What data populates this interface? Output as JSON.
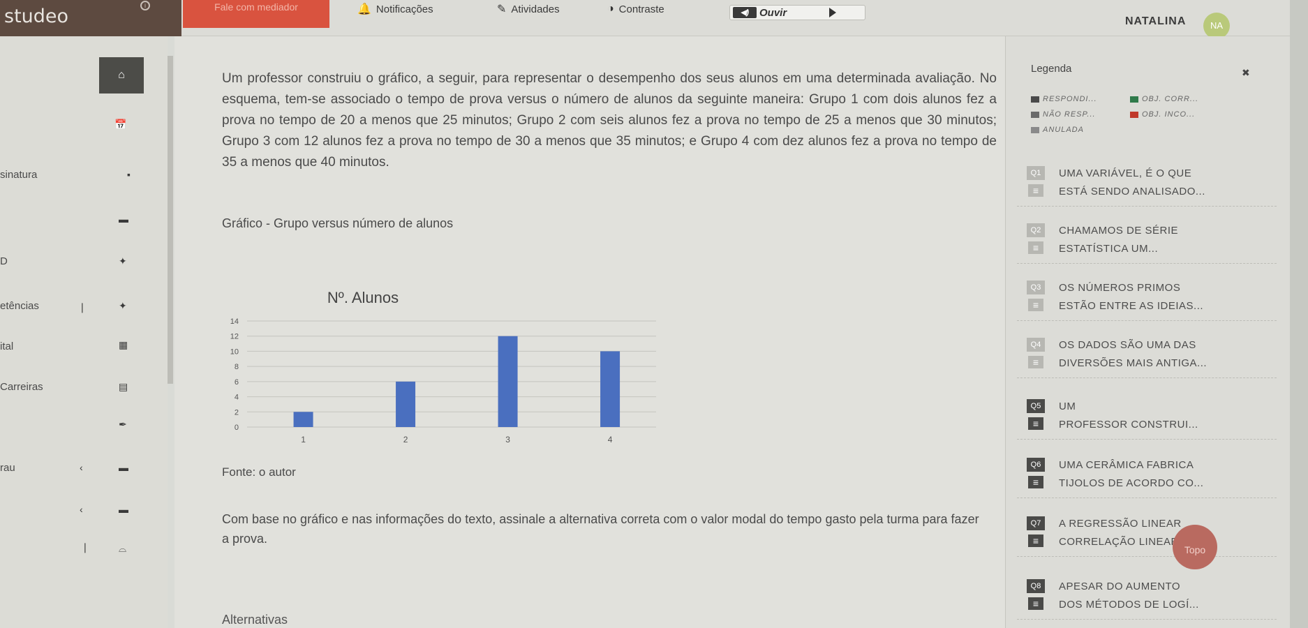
{
  "header": {
    "logo": "studeo",
    "mediator_button": "Fale com mediador",
    "nav": [
      {
        "label": "Notificações",
        "icon": "bell-icon"
      },
      {
        "label": "Atividades",
        "icon": "pencil-icon"
      },
      {
        "label": "Contraste",
        "icon": "contrast-icon"
      }
    ],
    "audio_label": "Ouvir",
    "user_name": "NATALINA",
    "avatar_initials": "NA"
  },
  "left_menu": {
    "items": [
      {
        "label": "",
        "icon": "home-icon"
      },
      {
        "label": "",
        "icon": "calendar-icon"
      },
      {
        "label": "sinatura",
        "icon": "book-icon"
      },
      {
        "label": "",
        "icon": "graduation-cap-icon"
      },
      {
        "label": "D",
        "icon": "puzzle-icon"
      },
      {
        "label": "etências",
        "icon": "puzzle-icon"
      },
      {
        "label": "ital",
        "icon": "calendar-icon"
      },
      {
        "label": "Carreiras",
        "icon": "briefcase-icon"
      },
      {
        "label": "",
        "icon": "pen-icon"
      },
      {
        "label": "rau",
        "icon": "graduation-cap-icon"
      },
      {
        "label": "",
        "icon": "graduation-cap-icon"
      },
      {
        "label": "",
        "icon": "folder-icon"
      }
    ]
  },
  "question": {
    "text": "Um professor construiu o gráfico, a seguir, para representar o desempenho dos seus alunos em uma determinada avaliação. No esquema, tem-se associado o tempo de prova versus o número de alunos da seguinte maneira: Grupo 1 com dois alunos fez a prova no tempo de 20 a menos que 25 minutos; Grupo 2 com seis alunos fez a prova no tempo de 25 a menos que 30 minutos; Grupo 3 com 12 alunos fez a prova no tempo de 30 a menos que 35 minutos; e Grupo 4 com dez alunos fez a prova no tempo de 35 a menos que 40 minutos.",
    "chart_caption": "Gráfico - Grupo versus número de alunos",
    "source": "Fonte: o autor",
    "statement": "Com base no gráfico e nas informações do texto, assinale a alternativa correta com o valor modal do tempo gasto pela turma para fazer a prova.",
    "alternatives_heading": "Alternativas"
  },
  "chart_data": {
    "type": "bar",
    "title": "Nº. Alunos",
    "categories": [
      "1",
      "2",
      "3",
      "4"
    ],
    "values": [
      2,
      6,
      12,
      10
    ],
    "ylim": [
      0,
      14
    ],
    "yticks": [
      "0",
      "2",
      "4",
      "6",
      "8",
      "10",
      "12",
      "14"
    ],
    "grid": true,
    "color": "#4a6fbf"
  },
  "legend": {
    "title": "Legenda",
    "items": [
      {
        "label": "RESPONDI...",
        "color": "#4a4a4a"
      },
      {
        "label": "OBJ. CORR...",
        "color": "#2f7a4a"
      },
      {
        "label": "NÃO RESP...",
        "color": "#6a6a6a"
      },
      {
        "label": "OBJ. INCO...",
        "color": "#c0392b"
      },
      {
        "label": "ANULADA",
        "color": "#8a8a8a"
      }
    ]
  },
  "question_list": [
    {
      "num": "Q1",
      "line1": "UMA VARIÁVEL, É O QUE",
      "line2": "ESTÁ SENDO ANALISADO...",
      "color": "#b7b7b2"
    },
    {
      "num": "Q2",
      "line1": "CHAMAMOS DE SÉRIE",
      "line2": "ESTATÍSTICA UM...",
      "color": "#b7b7b2"
    },
    {
      "num": "Q3",
      "line1": "OS NÚMEROS PRIMOS",
      "line2": "ESTÃO ENTRE AS IDEIAS...",
      "color": "#b7b7b2"
    },
    {
      "num": "Q4",
      "line1": "OS DADOS SÃO UMA DAS",
      "line2": "DIVERSÕES MAIS ANTIGA...",
      "color": "#b7b7b2"
    },
    {
      "num": "Q5",
      "line1": "UM",
      "line2": "PROFESSOR CONSTRUI...",
      "color": "#4a4a48"
    },
    {
      "num": "Q6",
      "line1": "UMA CERÂMICA FABRICA",
      "line2": "TIJOLOS DE ACORDO CO...",
      "color": "#4a4a48"
    },
    {
      "num": "Q7",
      "line1": "A REGRESSÃO LINEAR",
      "line2": "CORRELAÇÃO LINEAR",
      "color": "#4a4a48"
    },
    {
      "num": "Q8",
      "line1": "APESAR DO AUMENTO",
      "line2": "DOS MÉTODOS DE LOGÍ...",
      "color": "#4a4a48"
    }
  ],
  "back_to_top": "Topo"
}
